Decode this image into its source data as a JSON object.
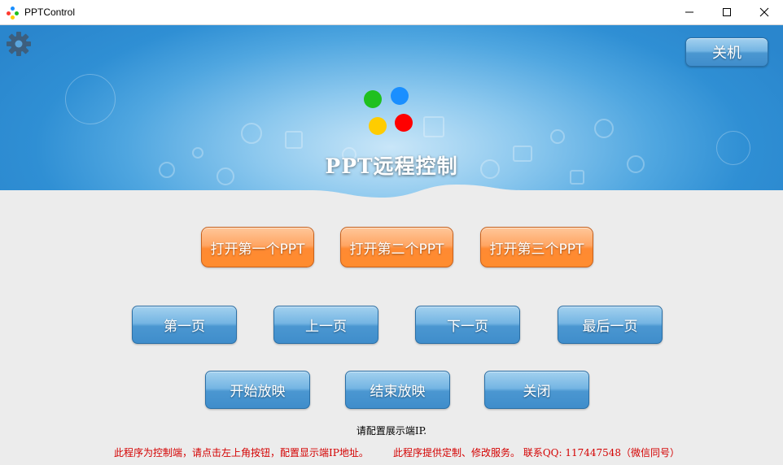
{
  "window": {
    "title": "PPTControl",
    "controls": [
      "minimize",
      "maximize",
      "close"
    ]
  },
  "header": {
    "logo_title": "PPT远程控制",
    "shutdown_label": "关机",
    "logo_dot_colors": [
      "#1fc01f",
      "#1a8fff",
      "#ffcc00",
      "#ff0000"
    ]
  },
  "buttons": {
    "open_ppt": [
      "打开第一个PPT",
      "打开第二个PPT",
      "打开第三个PPT"
    ],
    "navigation": [
      "第一页",
      "上一页",
      "下一页",
      "最后一页"
    ],
    "show_controls": [
      "开始放映",
      "结束放映",
      "关闭"
    ]
  },
  "status_text": "请配置展示端IP.",
  "footer": {
    "note_left": "此程序为控制端，请点击左上角按钮，配置显示端IP地址。",
    "note_right": "此程序提供定制、修改服务。   联系QQ: 117447548（微信同号）"
  },
  "colors": {
    "header_blue": "#2a86cd",
    "button_blue": "#4b97d1",
    "button_orange": "#ff8a32",
    "footer_red": "#d40000",
    "background": "#ececec"
  }
}
